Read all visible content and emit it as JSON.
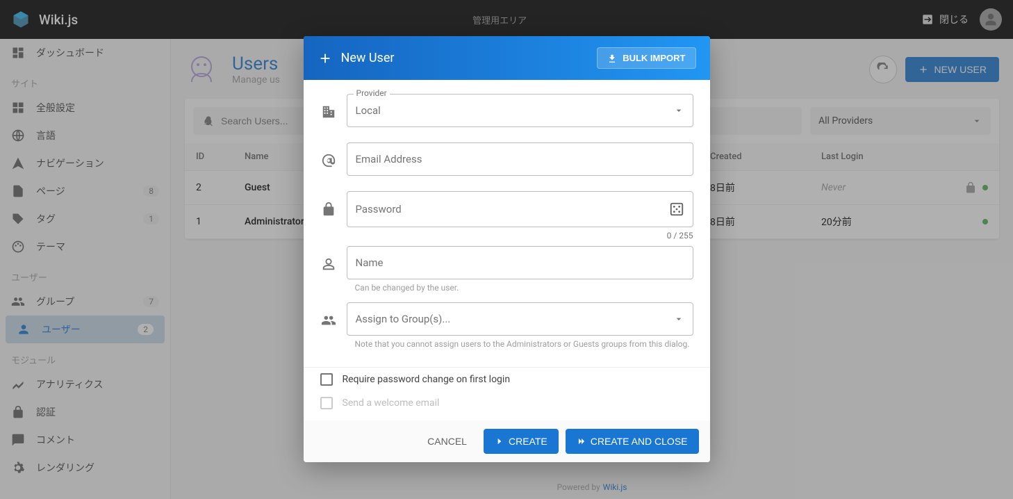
{
  "topbar": {
    "app_name": "Wiki.js",
    "center_label": "管理用エリア",
    "close_label": "閉じる"
  },
  "sidebar": {
    "items": [
      {
        "icon": "dashboard",
        "label": "ダッシュボード"
      }
    ],
    "section_site": "サイト",
    "site_items": [
      {
        "icon": "settings",
        "label": "全般設定"
      },
      {
        "icon": "language",
        "label": "言語"
      },
      {
        "icon": "near_me",
        "label": "ナビゲーション"
      },
      {
        "icon": "page",
        "label": "ページ",
        "badge": "8"
      },
      {
        "icon": "tag",
        "label": "タグ",
        "badge": "1"
      },
      {
        "icon": "palette",
        "label": "テーマ"
      }
    ],
    "section_users": "ユーザー",
    "user_items": [
      {
        "icon": "groups",
        "label": "グループ",
        "badge": "7"
      },
      {
        "icon": "person",
        "label": "ユーザー",
        "badge": "2",
        "active": true
      }
    ],
    "section_modules": "モジュール",
    "module_items": [
      {
        "icon": "analytics",
        "label": "アナリティクス"
      },
      {
        "icon": "lock",
        "label": "認証"
      },
      {
        "icon": "comment",
        "label": "コメント"
      },
      {
        "icon": "render",
        "label": "レンダリング"
      }
    ]
  },
  "page": {
    "title": "Users",
    "subtitle": "Manage us",
    "new_user_btn": "NEW USER",
    "search_placeholder": "Search Users...",
    "provider_filter": "All Providers",
    "columns": {
      "id": "ID",
      "name": "Name",
      "created": "Created",
      "lastlogin": "Last Login"
    },
    "rows": [
      {
        "id": "2",
        "name": "Guest",
        "created": "8日前",
        "lastlogin": "Never",
        "never": true,
        "locked": true
      },
      {
        "id": "1",
        "name": "Administrator",
        "created": "8日前",
        "lastlogin": "20分前"
      }
    ]
  },
  "footer": {
    "prefix": "Powered by",
    "link": "Wiki.js"
  },
  "dialog": {
    "title": "New User",
    "bulk_import": "BULK IMPORT",
    "provider_label": "Provider",
    "provider_value": "Local",
    "email_placeholder": "Email Address",
    "password_placeholder": "Password",
    "password_counter": "0 / 255",
    "name_placeholder": "Name",
    "name_hint": "Can be changed by the user.",
    "groups_placeholder": "Assign to Group(s)...",
    "groups_hint": "Note that you cannot assign users to the Administrators or Guests groups from this dialog.",
    "require_pwd_change": "Require password change on first login",
    "send_welcome": "Send a welcome email",
    "cancel": "CANCEL",
    "create": "CREATE",
    "create_close": "CREATE AND CLOSE"
  }
}
